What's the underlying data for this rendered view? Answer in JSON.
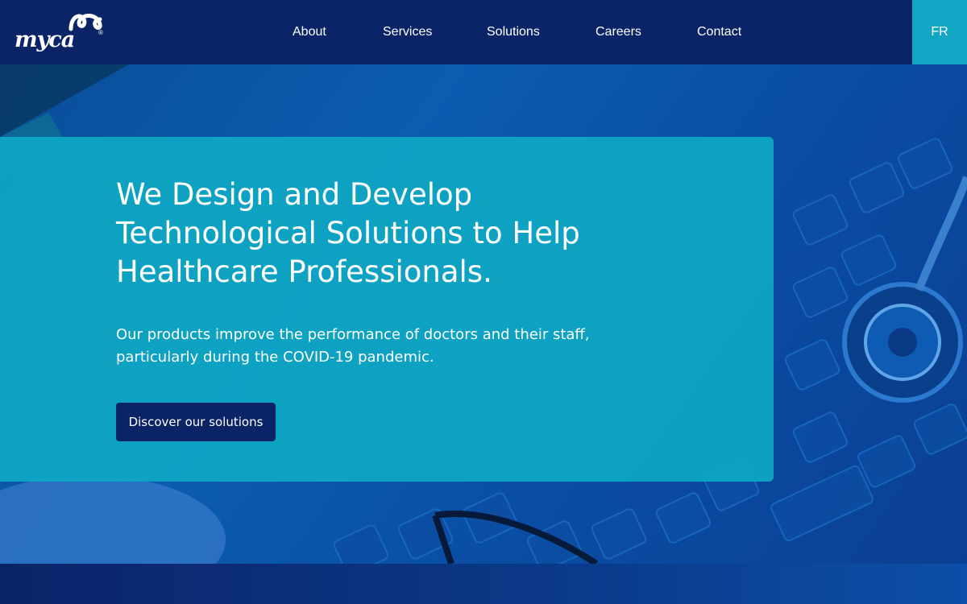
{
  "brand": {
    "logo_text": "myca",
    "logo_mark": "registered"
  },
  "nav": {
    "items": [
      {
        "label": "About"
      },
      {
        "label": "Services"
      },
      {
        "label": "Solutions"
      },
      {
        "label": "Careers"
      },
      {
        "label": "Contact"
      }
    ],
    "language": "FR"
  },
  "hero": {
    "title": "We Design and Develop Technological Solutions to Help Healthcare Professionals.",
    "subtitle": "Our products improve the performance of doctors and their staff, particularly during the COVID-19 pandemic.",
    "cta_label": "Discover our solutions",
    "background_image": "keyboard-with-stethoscope-and-glasses"
  },
  "colors": {
    "header_bg": "#0b2468",
    "accent_teal": "#13a6c4",
    "hero_card": "#0ea8c4",
    "hero_bg": "#0b5db0",
    "button_bg": "#0b2468",
    "text_on_dark": "#ffffff"
  }
}
